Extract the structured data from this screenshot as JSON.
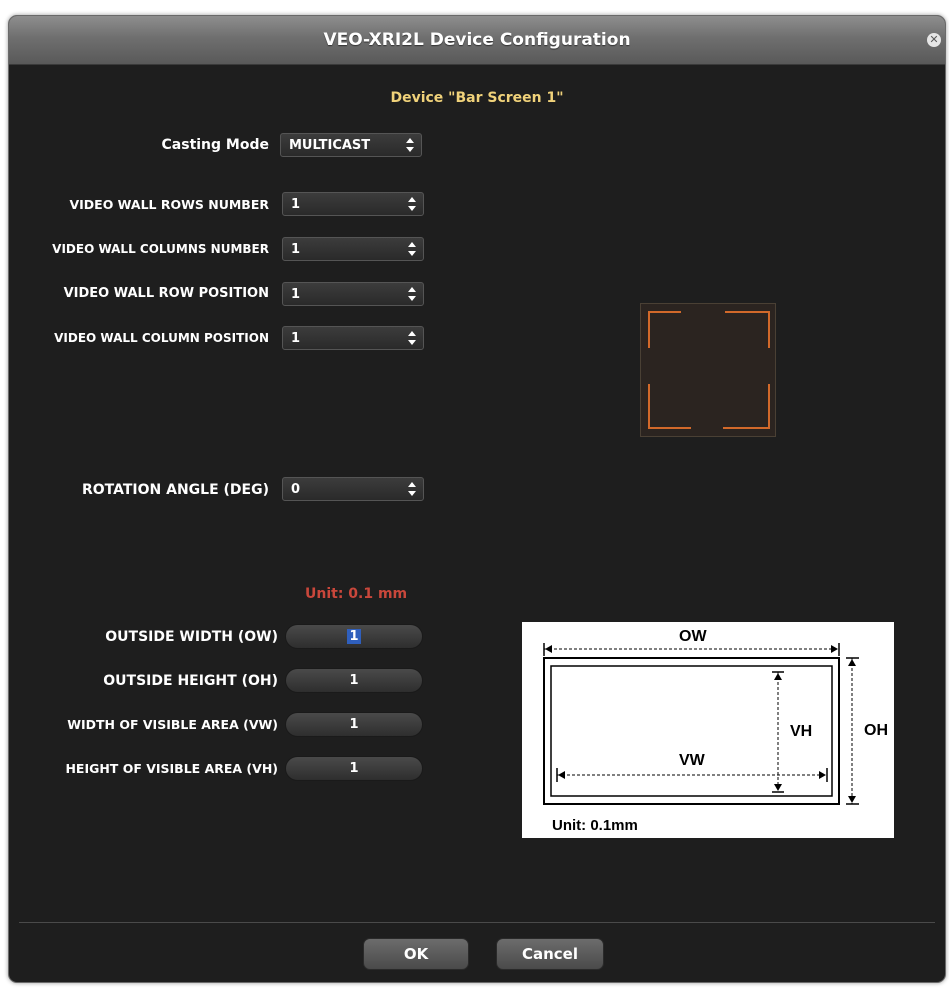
{
  "window": {
    "title": "VEO-XRI2L Device Configuration",
    "close_glyph": "✕"
  },
  "device_label": "Device \"Bar Screen 1\"",
  "casting": {
    "label": "Casting Mode",
    "value": "MULTICAST"
  },
  "video_wall": {
    "rows": {
      "label": "VIDEO WALL ROWS NUMBER",
      "value": "1"
    },
    "columns": {
      "label": "VIDEO WALL COLUMNS NUMBER",
      "value": "1"
    },
    "row_position": {
      "label": "VIDEO WALL ROW POSITION",
      "value": "1"
    },
    "column_position": {
      "label": "VIDEO WALL COLUMN POSITION",
      "value": "1"
    }
  },
  "rotation": {
    "label": "ROTATION ANGLE (DEG)",
    "value": "0"
  },
  "unit_note": "Unit: 0.1 mm",
  "dimensions": {
    "outside_width": {
      "label": "OUTSIDE WIDTH (OW)",
      "value": "1"
    },
    "outside_height": {
      "label": "OUTSIDE HEIGHT (OH)",
      "value": "1"
    },
    "visible_width": {
      "label": "WIDTH OF VISIBLE AREA (VW)",
      "value": "1"
    },
    "visible_height": {
      "label": "HEIGHT OF VISIBLE AREA (VH)",
      "value": "1"
    }
  },
  "diagram": {
    "ow": "OW",
    "oh": "OH",
    "vw": "VW",
    "vh": "VH",
    "unit": "Unit: 0.1mm"
  },
  "buttons": {
    "ok": "OK",
    "cancel": "Cancel"
  },
  "colors": {
    "background": "#1e1e1e",
    "device_label": "#f0d27a",
    "unit_note": "#c9473b",
    "preview_border": "#d2692a",
    "text_selection": "#2f5fbd"
  },
  "icons": [
    "close-icon",
    "updown-arrows-icon"
  ]
}
